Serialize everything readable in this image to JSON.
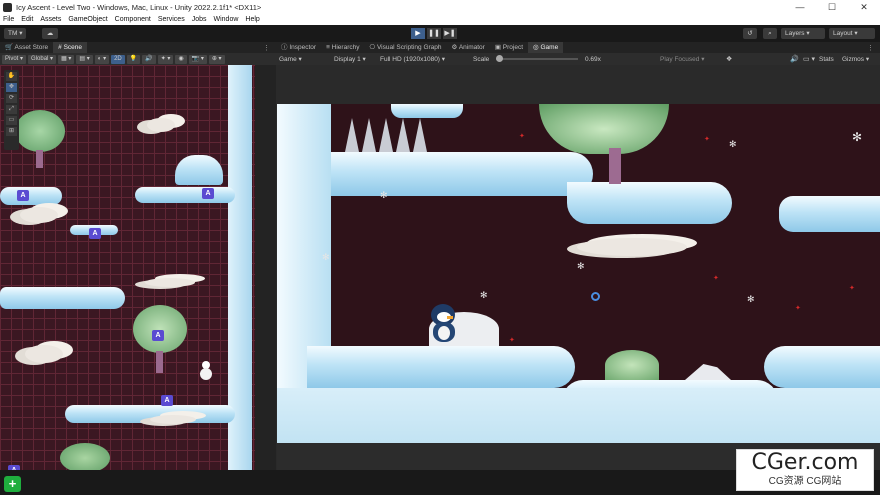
{
  "window": {
    "title": "Icy Ascent - Level Two - Windows, Mac, Linux - Unity 2022.2.1f1* <DX11>",
    "minimize": "—",
    "maximize": "☐",
    "close": "✕"
  },
  "menu": [
    "File",
    "Edit",
    "Assets",
    "GameObject",
    "Component",
    "Services",
    "Jobs",
    "Window",
    "Help"
  ],
  "toolbar": {
    "account": "TM",
    "layers": "Layers",
    "layout": "Layout"
  },
  "left_tabs": [
    "Asset Store",
    "Scene"
  ],
  "scene_toolbar": [
    "Pivot",
    "Global",
    "2D"
  ],
  "right_tabs": [
    "Inspector",
    "Hierarchy",
    "Visual Scripting Graph",
    "Animator",
    "Project",
    "Game"
  ],
  "game_toolbar": {
    "view": "Game",
    "display": "Display 1",
    "resolution": "Full HD (1920x1080)",
    "scale_label": "Scale",
    "scale_value": "0.69x",
    "play_focused": "Play Focused",
    "stats": "Stats",
    "gizmos": "Gizmos"
  },
  "watermark": {
    "line1": "CGer.com",
    "line2": "CG资源 CG网站"
  },
  "colors": {
    "scene_bg": "#3b1722",
    "game_bg": "#2e1219",
    "accent": "#3d5f8c",
    "add_icon": "#1fae3e"
  }
}
